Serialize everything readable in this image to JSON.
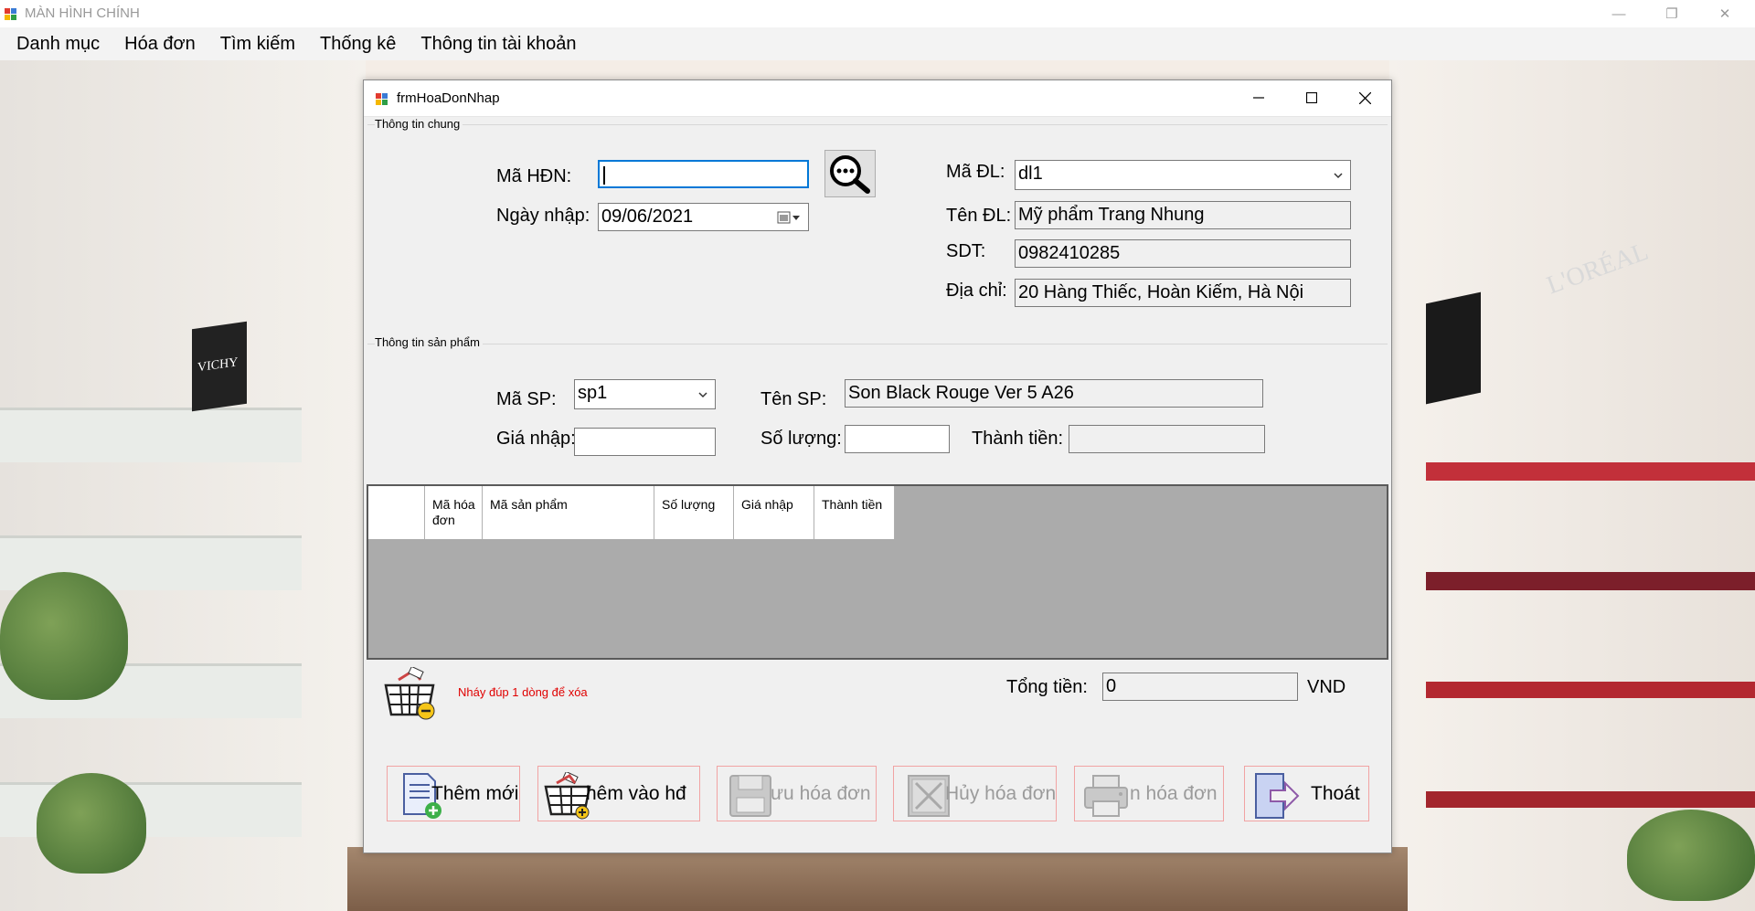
{
  "window": {
    "title": "MÀN HÌNH CHÍNH",
    "minimize": "—",
    "restore": "❐",
    "close": "✕"
  },
  "menu": [
    "Danh mục",
    "Hóa đơn",
    "Tìm kiếm",
    "Thống kê",
    "Thông tin tài khoản"
  ],
  "background": {
    "brand_left": "VICHY",
    "brand_right": "L'ORÉAL"
  },
  "form": {
    "title": "frmHoaDonNhap",
    "general_group": "Thông tin chung",
    "product_group": "Thông tin sản phẩm",
    "ma_hdn_label": "Mã HĐN:",
    "ma_hdn_value": "",
    "ngay_nhap_label": "Ngày nhập:",
    "ngay_nhap_value": "09/06/2021",
    "ma_dl_label": "Mã ĐL:",
    "ma_dl_value": "dl1",
    "ten_dl_label": "Tên ĐL:",
    "ten_dl_value": "Mỹ phẩm Trang Nhung",
    "sdt_label": "SDT:",
    "sdt_value": "0982410285",
    "dia_chi_label": "Địa chỉ:",
    "dia_chi_value": "20 Hàng Thiếc, Hoàn Kiếm, Hà Nội",
    "ma_sp_label": "Mã SP:",
    "ma_sp_value": "sp1",
    "ten_sp_label": "Tên SP:",
    "ten_sp_value": "Son Black Rouge Ver 5 A26",
    "gia_nhap_label": "Giá nhập:",
    "gia_nhap_value": "",
    "so_luong_label": "Số lượng:",
    "so_luong_value": "",
    "thanh_tien_label": "Thành tiền:",
    "thanh_tien_value": "",
    "grid_columns": [
      "Mã hóa đơn",
      "Mã sản phẩm",
      "Số lượng",
      "Giá nhập",
      "Thành tiền"
    ],
    "delete_hint": "Nháy đúp 1 dòng để xóa",
    "tong_tien_label": "Tổng tiền:",
    "tong_tien_value": "0",
    "currency": "VND",
    "buttons": {
      "them_moi": "Thêm mới",
      "them_vao_hd": "hêm vào hđ",
      "luu": "ưu hóa đơn",
      "huy": "Hủy hóa đơn",
      "in": "n hóa đơn",
      "thoat": "Thoát"
    }
  },
  "colors": {
    "focus_border": "#0078d7",
    "button_border": "#f1a3a3",
    "hint_text": "#e00000",
    "grid_bg": "#ababab"
  }
}
